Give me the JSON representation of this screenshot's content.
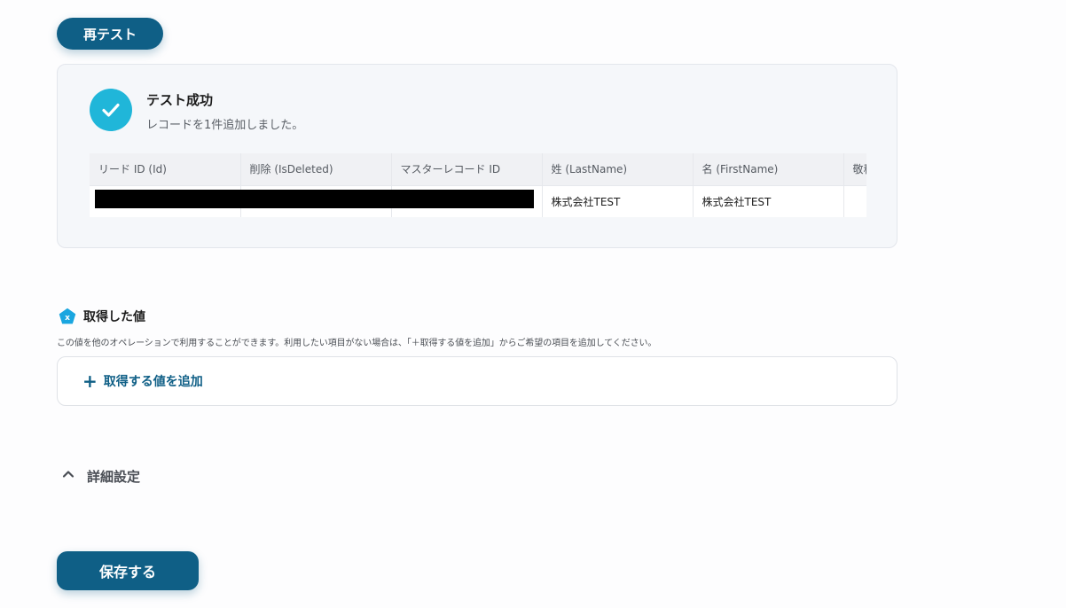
{
  "buttons": {
    "retest_label": "再テスト",
    "save_label": "保存する"
  },
  "result": {
    "title": "テスト成功",
    "subtitle": "レコードを1件追加しました。",
    "icon": "check-circle-icon",
    "columns": [
      "リード ID (Id)",
      "削除 (IsDeleted)",
      "マスターレコード ID",
      "姓 (LastName)",
      "名 (FirstName)",
      "敬称"
    ],
    "rows": [
      [
        "",
        "",
        "",
        "株式会社TEST",
        "株式会社TEST",
        ""
      ]
    ]
  },
  "acquired": {
    "icon": "variable-pentagon-icon",
    "icon_glyph": "x",
    "title": "取得した値",
    "description": "この値を他のオペレーションで利用することができます。利用したい項目がない場合は、「＋取得する値を追加」からご希望の項目を追加してください。",
    "add_label": "取得する値を追加"
  },
  "details": {
    "label": "詳細設定",
    "icon": "chevron-up-icon"
  },
  "colors": {
    "primary": "#0f5f86",
    "success": "#20b6d9",
    "panel_bg": "#f5f7fa"
  }
}
